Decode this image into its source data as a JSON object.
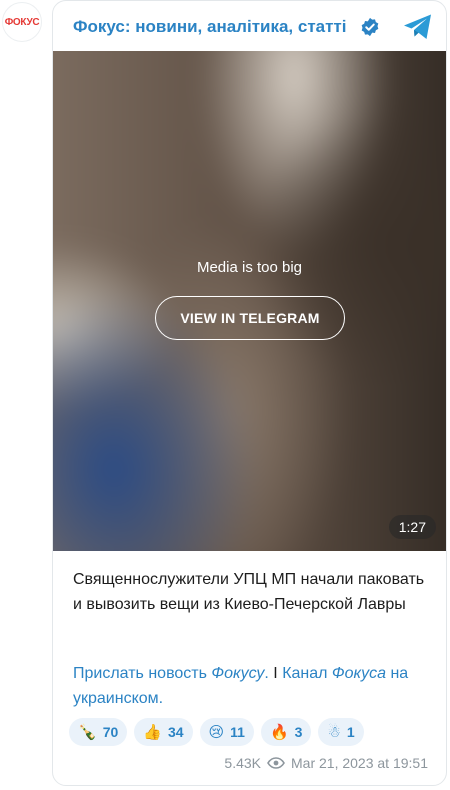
{
  "avatar": {
    "text": "ФОКУС"
  },
  "header": {
    "channel_title": "Фокус: новини, аналітика, статті"
  },
  "media": {
    "message": "Media is too big",
    "button_label": "VIEW IN TELEGRAM",
    "duration": "1:27"
  },
  "post": {
    "text": "Священнослужители УПЦ МП начали паковать и вывозить вещи из Киево-Печерской Лавры",
    "link1_prefix": "Прислать новость ",
    "link1_italic": "Фокусу",
    "link1_dot": ".",
    "separator": " І ",
    "link2_prefix": "Канал ",
    "link2_italic": "Фокуса",
    "link2_suffix": " на украинском",
    "link2_dot": "."
  },
  "reactions": [
    {
      "emoji": "🍾",
      "count": "70"
    },
    {
      "emoji": "👍",
      "count": "34"
    },
    {
      "emoji": "😢",
      "count": "11"
    },
    {
      "emoji": "🔥",
      "count": "3"
    },
    {
      "emoji": "☃",
      "count": "1"
    }
  ],
  "footer": {
    "views": "5.43K",
    "date": "Mar 21, 2023 at 19:51"
  },
  "colors": {
    "accent": "#2b83c4",
    "brand": "#e53935",
    "reaction_bg": "#eaf2fa"
  }
}
